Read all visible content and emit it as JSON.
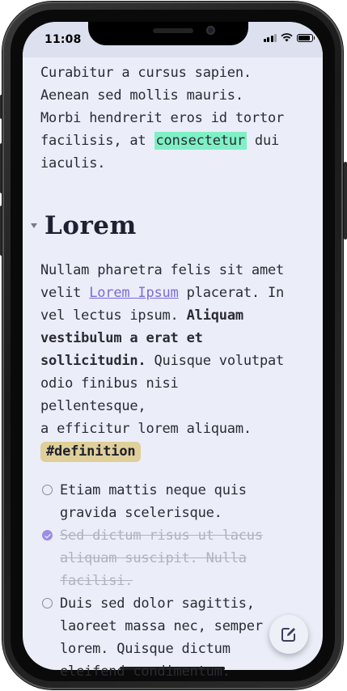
{
  "status": {
    "time": "11:08",
    "battery_level": 0.9,
    "signal_bars": 3
  },
  "doc": {
    "intro_lines": [
      "Curabitur a cursus sapien.",
      "Aenean sed mollis mauris.",
      "Morbi hendrerit eros id tortor"
    ],
    "intro_pre": "facilisis, at ",
    "intro_highlight": "consectetur",
    "intro_post": " dui",
    "intro_last": "iaculis.",
    "heading": "Lorem",
    "p2_line1": "Nullam pharetra felis sit amet",
    "p2_pre_link": "velit ",
    "link": "Lorem Ipsum",
    "p2_post_link": " placerat. In",
    "p2_line3_pre": "vel lectus ipsum. ",
    "bold_1": "Aliquam",
    "bold_2": "vestibulum a erat et",
    "bold_3": "sollicitudin.",
    "p2_after_bold": " Quisque volutpat",
    "p2_line7": "odio finibus nisi pellentesque,",
    "p2_line8": "a efficitur lorem aliquam.",
    "tag": "#definition",
    "tasks": [
      {
        "line1": "Etiam mattis neque quis",
        "line2": "gravida scelerisque.",
        "line3": "",
        "line4": "",
        "done": false
      },
      {
        "line1": "Sed dictum risus ut lacus",
        "line2": "aliquam suscipit. Nulla",
        "line3": "facilisi.",
        "line4": "",
        "done": true
      },
      {
        "line1": "Duis sed dolor sagittis,",
        "line2": "laoreet massa nec, semper",
        "line3": "lorem. Quisque dictum",
        "line4": "eleifend condimentum.",
        "done": false
      }
    ]
  },
  "fab": {
    "icon": "edit-icon"
  },
  "colors": {
    "highlight": "#7ff0c6",
    "link": "#7b6cd6",
    "tag_bg": "#dfcf98",
    "check": "#9b8ce6",
    "background": "#ebedf8"
  }
}
